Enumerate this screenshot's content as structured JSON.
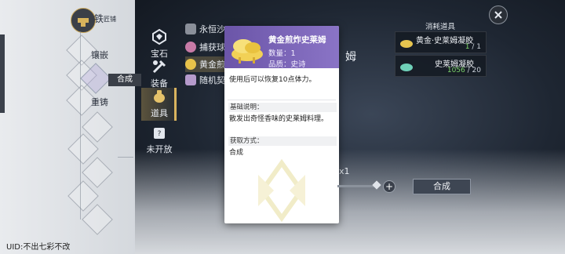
{
  "tree": {
    "top_label": "铁",
    "top_sub": "匠铺",
    "nodes": [
      "镶嵌",
      "重铸"
    ],
    "hint_label": "合成"
  },
  "categories": [
    {
      "label": "宝石",
      "icon": "gem-icon"
    },
    {
      "label": "装备",
      "icon": "equipment-icon"
    },
    {
      "label": "道具",
      "icon": "item-bag-icon"
    },
    {
      "label": "未开放",
      "icon": "locked-icon"
    }
  ],
  "item_list": [
    {
      "label": "永恒沙",
      "icon": "sand-icon",
      "color": "#8a8f99"
    },
    {
      "label": "捕获球",
      "icon": "capture-ball-icon",
      "color": "#c77aa6"
    },
    {
      "label": "黄金煎",
      "icon": "golden-slime-icon",
      "color": "#e8c24a"
    },
    {
      "label": "随机契",
      "icon": "contract-icon",
      "color": "#b59acb"
    }
  ],
  "popup": {
    "name": "黄金煎炸史莱姆",
    "quantity": "数量：1",
    "quality": "品质：史诗",
    "usage": "使用后可以恢复10点体力。",
    "basic_title": "基础说明：",
    "basic_text": "散发出奇怪香味的史莱姆料理。",
    "source_title": "获取方式：",
    "source_text": "合成"
  },
  "bg_text": {
    "right_name_tail": "姆",
    "multiplier": "x1"
  },
  "consumables": {
    "title": "消耗道具",
    "items": [
      {
        "name": "黄金·史莱姆凝胶",
        "have": "1",
        "need": "/ 1"
      },
      {
        "name": "史莱姆凝胶",
        "have": "1056",
        "need": "/ 20"
      }
    ]
  },
  "craft_button": "合成",
  "plus_label": "+",
  "uid": "UID:不出七彩不改",
  "colors": {
    "accent_gold": "#d9b35e",
    "epic_purple": "#7a62b8",
    "have_green": "#7bd36a"
  }
}
